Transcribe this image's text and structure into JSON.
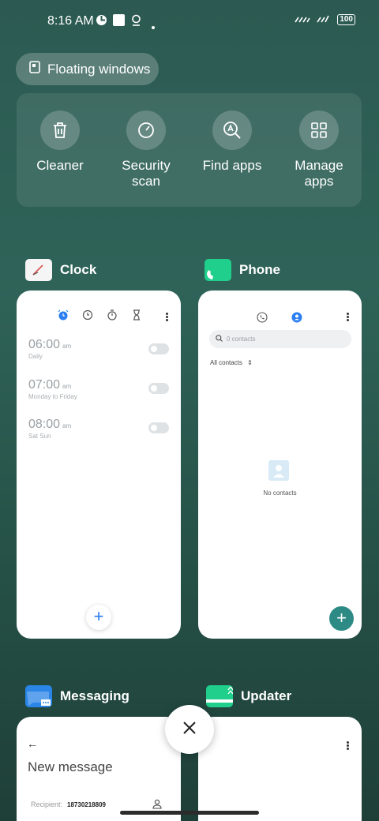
{
  "status_bar": {
    "time": "8:16 AM",
    "battery": "100"
  },
  "floating_windows": {
    "label": "Floating windows"
  },
  "quick_actions": [
    {
      "label": "Cleaner",
      "icon": "trash-icon"
    },
    {
      "label": "Security\nscan",
      "icon": "security-scan-icon"
    },
    {
      "label": "Find apps",
      "icon": "find-apps-icon"
    },
    {
      "label": "Manage\napps",
      "icon": "grid-icon"
    }
  ],
  "apps": {
    "clock": {
      "name": "Clock",
      "alarms": [
        {
          "time": "06:00",
          "ampm": "am",
          "repeat": "Daily"
        },
        {
          "time": "07:00",
          "ampm": "am",
          "repeat": "Monday to Friday"
        },
        {
          "time": "08:00",
          "ampm": "am",
          "repeat": "Sat Sun"
        }
      ],
      "add": "+"
    },
    "phone": {
      "name": "Phone",
      "search_placeholder": "0 contacts",
      "filter": "All contacts",
      "empty": "No contacts",
      "add": "+"
    },
    "messaging": {
      "name": "Messaging",
      "title": "New message",
      "recipient_label": "Recipient:",
      "recipient_value": "18730218809"
    },
    "updater": {
      "name": "Updater"
    }
  },
  "colors": {
    "accent_blue": "#2a7ef2",
    "teal": "#2e8a85",
    "phone_green": "#1fcf8b"
  }
}
